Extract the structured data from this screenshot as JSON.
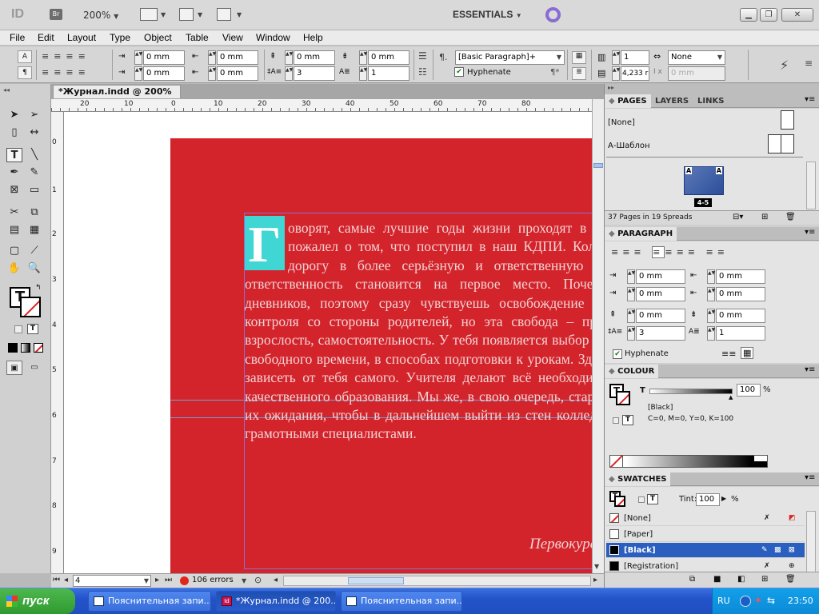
{
  "app": {
    "logo": "ID",
    "bridge_label": "Br",
    "zoom": "200%",
    "workspace": "ESSENTIALS"
  },
  "menu": [
    "File",
    "Edit",
    "Layout",
    "Type",
    "Object",
    "Table",
    "View",
    "Window",
    "Help"
  ],
  "control_panel": {
    "left_indent": "0 mm",
    "right_indent": "0 mm",
    "first_line_indent": "0 mm",
    "last_line_indent": "0 mm",
    "space_before": "0 mm",
    "space_after": "0 mm",
    "drop_cap_lines": "3",
    "drop_cap_chars": "1",
    "paragraph_style": "[Basic Paragraph]+",
    "hyphenate_label": "Hyphenate",
    "columns": "1",
    "column_span": "None",
    "column_width": "4,233 r",
    "gutter": "0 mm"
  },
  "document": {
    "tab_title": "*Журнал.indd @ 200%",
    "ruler_top": [
      "20",
      "10",
      "0",
      "10",
      "20",
      "30",
      "40",
      "50",
      "60",
      "70",
      "80"
    ],
    "ruler_left": [
      "0",
      "1",
      "2",
      "3",
      "4",
      "5",
      "6",
      "7",
      "8",
      "9"
    ],
    "drop_cap": "Г",
    "body_text": "оворят, самые лучшие годы жизни проходят в школе, но я не пожалел о том, что поступил в наш КДПИ. Колледж открывает дорогу в более серьёзную и ответственную жизнь. Именно ответственность становится на первое место. Почему? Здесь нет дневников, поэтому сразу чувствуешь освобождение от ежедневного контроля со стороны родителей, но эта свобода – проверка тебя на взрослость, самостоятельность. У тебя появляется выбор в распределении свободного времени, в способах подготовки к урокам. Здесь начинает всё зависеть от тебя самого. Учителя делают всё необходимое для нашего качественного образования. Мы же, в свою очередь, стараемся оправдать их ожидания, чтобы в дальнейшем выйти из стен колледжа хорошими и грамотными специалистами.",
    "signature": "Первокурсник"
  },
  "status": {
    "page": "4",
    "errors": "106 errors"
  },
  "panels": {
    "pages": {
      "tabs": [
        "PAGES",
        "LAYERS",
        "LINKS"
      ],
      "none_master": "[None]",
      "a_master": "А-Шаблон",
      "spread_label": "4-5",
      "footer": "37 Pages in 19 Spreads"
    },
    "paragraph": {
      "title": "PARAGRAPH",
      "left_indent": "0 mm",
      "right_indent": "0 mm",
      "first_line_indent": "0 mm",
      "last_line_indent": "0 mm",
      "space_before": "0 mm",
      "space_after": "0 mm",
      "drop_lines": "3",
      "drop_chars": "1",
      "hyphenate": "Hyphenate"
    },
    "colour": {
      "title": "COLOUR",
      "tint_label": "T",
      "tint": "100",
      "pct": "%",
      "name": "[Black]",
      "values": "C=0, M=0, Y=0, K=100"
    },
    "swatches": {
      "title": "SWATCHES",
      "tint_label": "Tint:",
      "tint": "100",
      "pct": "%",
      "items": [
        "[None]",
        "[Paper]",
        "[Black]",
        "[Registration]"
      ]
    }
  },
  "taskbar": {
    "start": "пуск",
    "tasks": [
      "Пояснительная запи...",
      "*Журнал.indd @ 200...",
      "Пояснительная запи..."
    ],
    "lang": "RU",
    "time": "23:50"
  },
  "colors": {
    "page_red": "#d3242c",
    "drop_cap_bg": "#3fd6d3",
    "selection_blue": "#2a5fbf"
  }
}
